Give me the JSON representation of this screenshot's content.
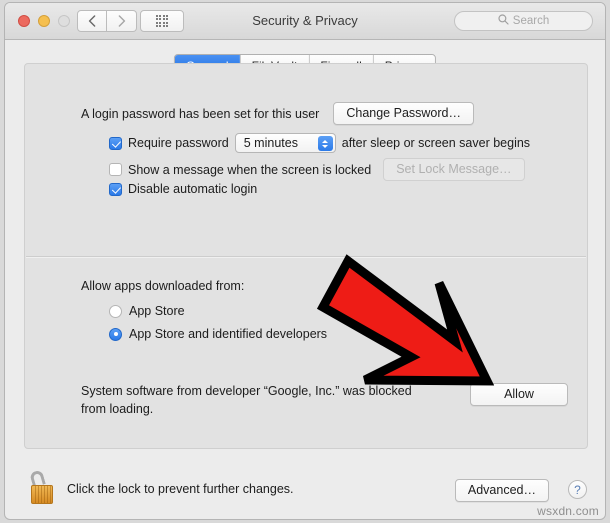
{
  "window": {
    "title": "Security & Privacy",
    "traffic_lights": [
      "close",
      "minimize",
      "zoom-disabled"
    ],
    "nav": {
      "back_icon": "chevron-left-icon",
      "forward_icon": "chevron-right-icon",
      "grid_icon": "show-all-grid-icon"
    },
    "search": {
      "placeholder": "Search",
      "icon": "search-icon",
      "value": ""
    }
  },
  "tabs": [
    {
      "label": "General",
      "active": true
    },
    {
      "label": "FileVault",
      "active": false
    },
    {
      "label": "Firewall",
      "active": false
    },
    {
      "label": "Privacy",
      "active": false
    }
  ],
  "general": {
    "login_password_text": "A login password has been set for this user",
    "change_password_button": "Change Password…",
    "require_password": {
      "checked": true,
      "label_before": "Require password",
      "delay_value": "5 minutes",
      "label_after": "after sleep or screen saver begins"
    },
    "show_message": {
      "checked": false,
      "label": "Show a message when the screen is locked",
      "button": "Set Lock Message…",
      "button_disabled": true
    },
    "disable_auto_login": {
      "checked": true,
      "label": "Disable automatic login"
    },
    "allow_apps_heading": "Allow apps downloaded from:",
    "allow_apps_options": [
      {
        "label": "App Store",
        "selected": false
      },
      {
        "label": "App Store and identified developers",
        "selected": true
      }
    ],
    "blocked_notice": {
      "line1": "System software from developer “Google, Inc.” was blocked",
      "line2": "from loading.",
      "button": "Allow"
    }
  },
  "bottom": {
    "lock_icon": "open-padlock-icon",
    "lock_text": "Click the lock to prevent further changes.",
    "advanced_button": "Advanced…",
    "help_button": "?"
  },
  "annotation": {
    "arrow_icon": "red-arrow-down-right",
    "fill_color": "#ee1c16",
    "stroke_color": "#000000"
  },
  "watermark": "wsxdn.com"
}
